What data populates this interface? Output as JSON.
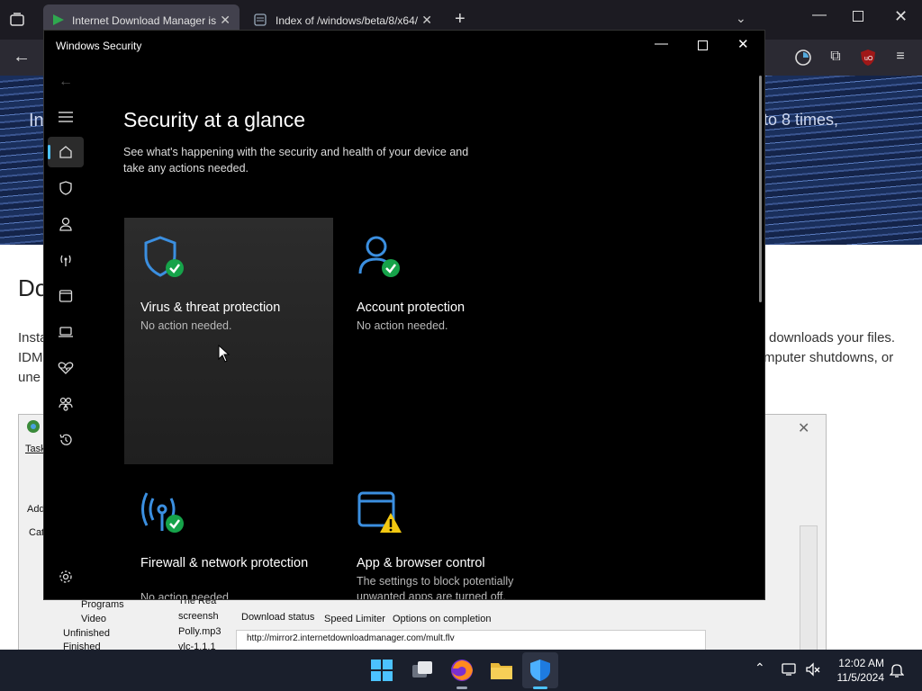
{
  "browser": {
    "tabs": [
      {
        "label": "Internet Download Manager is"
      },
      {
        "label": "Index of /windows/beta/8/x64/"
      }
    ],
    "new_tab": "+",
    "close": "✕"
  },
  "webpage": {
    "banner_left": "In",
    "banner_right": "to 8 times,",
    "heading": "Do",
    "left_lines": [
      "Insta",
      "IDM",
      "une"
    ],
    "right_lines": [
      "downloads your files.",
      "mputer shutdowns, or"
    ],
    "idm": {
      "menu_task": "Task",
      "add": "Add",
      "cat": "Cat",
      "tree": [
        "Programs",
        "Video",
        "Unfinished",
        "Finished"
      ],
      "files": [
        "The Rea",
        "screensh",
        "Polly.mp3",
        "vlc-1.1.1"
      ],
      "tabs": [
        "Download status",
        "Speed Limiter",
        "Options on completion"
      ],
      "url": "http://mirror2.internetdownloadmanager.com/mult.flv"
    }
  },
  "security": {
    "window_title": "Windows Security",
    "heading": "Security at a glance",
    "subtitle": "See what's happening with the security and health of your device and take any actions needed.",
    "cards": [
      {
        "title": "Virus & threat protection",
        "desc": "No action needed."
      },
      {
        "title": "Account protection",
        "desc": "No action needed."
      },
      {
        "title": "Firewall & network protection",
        "desc": "No action needed."
      },
      {
        "title": "App & browser control",
        "desc": "The settings to block potentially unwanted apps are turned off."
      }
    ],
    "colors": {
      "accent": "#4cc2ff",
      "ok": "#16a34a",
      "warn": "#f2c811",
      "icon_blue": "#3b8fe0"
    }
  },
  "taskbar": {
    "time": "12:02 AM",
    "date": "11/5/2024"
  }
}
